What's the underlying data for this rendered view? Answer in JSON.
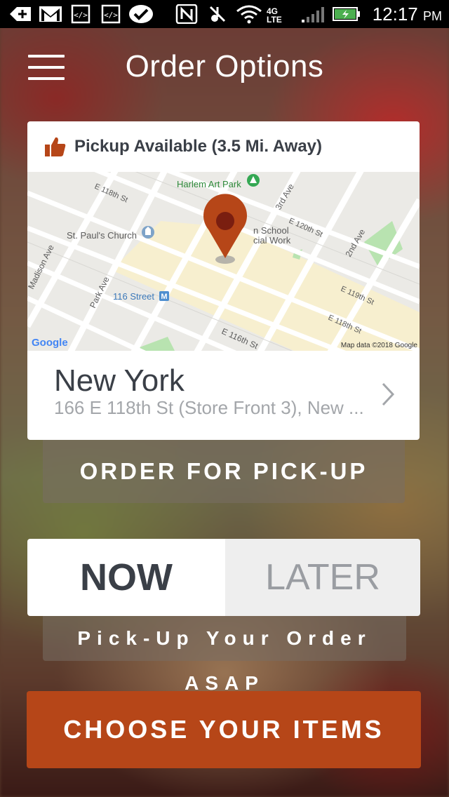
{
  "status_bar": {
    "time": "12:17",
    "ampm": "PM",
    "network": "4G LTE",
    "icons": [
      "add-icon",
      "gmail-icon",
      "code-icon",
      "code-icon",
      "check-icon",
      "nfc-icon",
      "mute-icon",
      "wifi-icon",
      "signal-icon",
      "battery-icon"
    ],
    "battery_color": "#4caf50"
  },
  "header": {
    "title": "Order Options",
    "menu_icon": "hamburger-menu-icon"
  },
  "pickup_card": {
    "availability": "Pickup Available (3.5 Mi. Away)",
    "thumb_icon": "thumbs-up-icon",
    "accent_color": "#b64618",
    "map": {
      "labels": [
        "Harlem Art Park",
        "E 118th St",
        "3rd Ave",
        "St. Paul's Church",
        "n School",
        "cial Work",
        "E 120th St",
        "2nd Ave",
        "Madison Ave",
        "Park Ave",
        "116 Street",
        "E 119th St",
        "E 118th St",
        "E 116th St"
      ],
      "google": "Google",
      "attribution": "Map data ©2018 Google"
    },
    "location": {
      "city": "New York",
      "address": "166 E 118th St (Store Front 3), New ..."
    }
  },
  "order_type_button": "ORDER FOR PICK-UP",
  "time_toggle": {
    "now": "NOW",
    "later": "LATER",
    "selected": "NOW"
  },
  "time_caption": "Pick-Up Your Order ASAP",
  "primary_action": "CHOOSE YOUR ITEMS"
}
